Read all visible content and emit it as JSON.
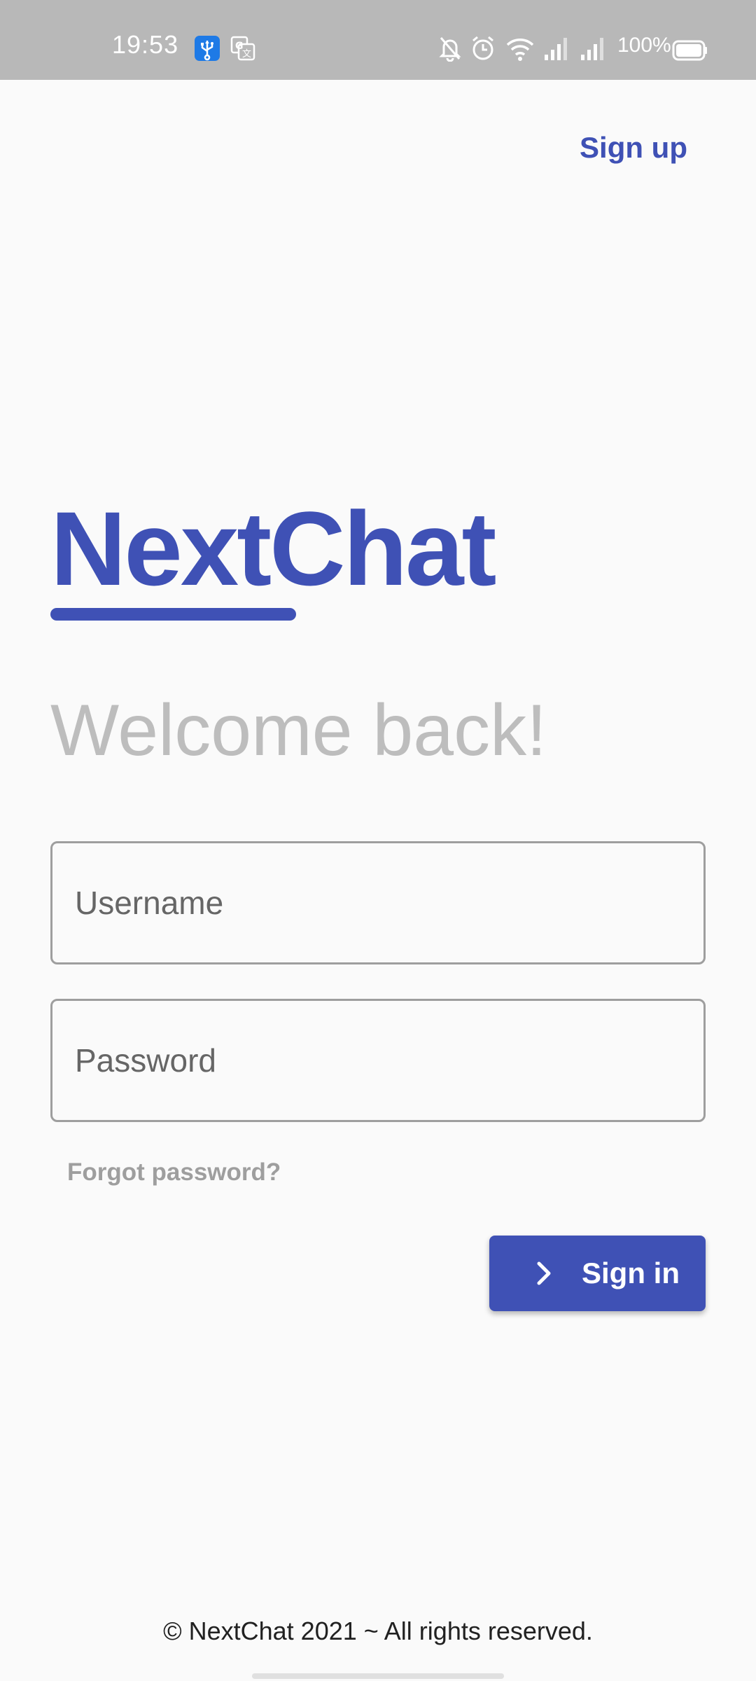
{
  "status_bar": {
    "time": "19:53",
    "battery_percent": "100%",
    "icons": [
      "usb-icon",
      "translate-icon",
      "mute-bell-icon",
      "alarm-icon",
      "wifi-icon",
      "signal-icon",
      "signal-icon",
      "battery-icon"
    ]
  },
  "header": {
    "signup_label": "Sign up"
  },
  "brand": {
    "name": "NextChat",
    "color": "#3f51b5"
  },
  "welcome": "Welcome back!",
  "form": {
    "username_placeholder": "Username",
    "password_placeholder": "Password",
    "forgot_label": "Forgot password?",
    "signin_label": "Sign in"
  },
  "footer": {
    "text": "© NextChat 2021 ~ All rights reserved."
  }
}
